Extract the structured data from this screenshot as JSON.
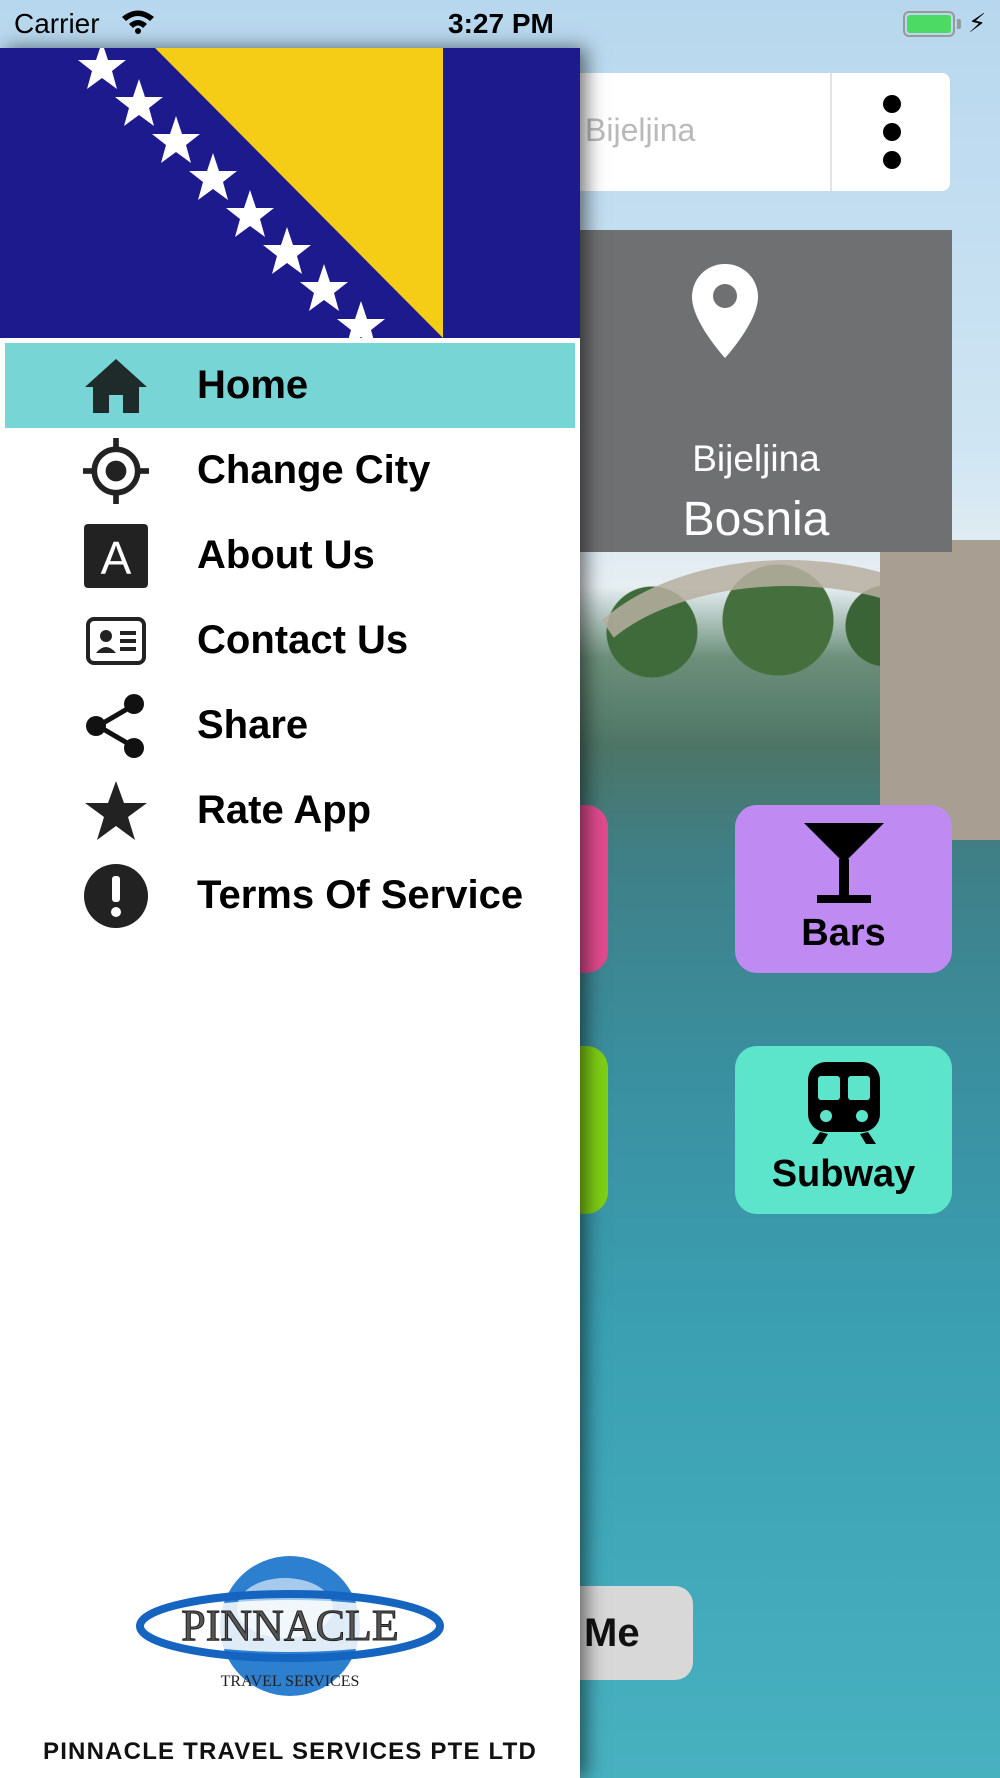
{
  "status_bar": {
    "carrier": "Carrier",
    "time": "3:27 PM",
    "battery_level": 1.0
  },
  "main": {
    "search_placeholder": "Bijeljina",
    "location_city": "Bijeljina",
    "location_country": "Bosnia",
    "tiles": [
      {
        "label": "Bars",
        "color": "#c08af3",
        "icon": "cocktail-icon"
      },
      {
        "label": "Subway",
        "color": "#5de5cb",
        "icon": "subway-icon"
      }
    ],
    "bottom_button_label": "Me"
  },
  "drawer": {
    "flag": "Bosnia and Herzegovina flag",
    "active_color": "#78d5d6",
    "items": [
      {
        "label": "Home",
        "icon": "home-icon"
      },
      {
        "label": "Change City",
        "icon": "crosshair-icon"
      },
      {
        "label": "About Us",
        "icon": "letter-a-icon"
      },
      {
        "label": "Contact Us",
        "icon": "contact-card-icon"
      },
      {
        "label": "Share",
        "icon": "share-icon"
      },
      {
        "label": "Rate App",
        "icon": "star-icon"
      },
      {
        "label": "Terms Of Service",
        "icon": "alert-icon"
      }
    ],
    "logo_text": "PINNACLE",
    "logo_subtext": "TRAVEL SERVICES",
    "company": "PINNACLE TRAVEL SERVICES PTE LTD"
  }
}
